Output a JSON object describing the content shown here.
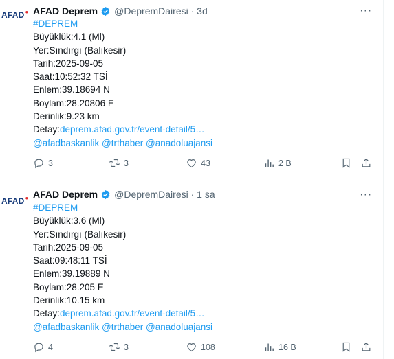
{
  "tweets": [
    {
      "author": "AFAD Deprem",
      "handle": "@DepremDairesi",
      "time": "· 3d",
      "avatar_text": "AFAD",
      "hashtag": "#DEPREM",
      "lines": [
        "Büyüklük:4.1 (Ml)",
        "Yer:Sındırgı (Balıkesir)",
        "Tarih:2025-09-05",
        "Saat:10:52:32 TSİ",
        "Enlem:39.18694 N",
        "Boylam:28.20806 E",
        "Derinlik:9.23 km"
      ],
      "detail_label": "Detay:",
      "detail_link": "deprem.afad.gov.tr/event-detail/5…",
      "mentions": "@afadbaskanlik @trthaber @anadoluajansi",
      "replies": "3",
      "retweets": "3",
      "likes": "43",
      "views": "2 B"
    },
    {
      "author": "AFAD Deprem",
      "handle": "@DepremDairesi",
      "time": "· 1 sa",
      "avatar_text": "AFAD",
      "hashtag": "#DEPREM",
      "lines": [
        "Büyüklük:3.6 (Ml)",
        "Yer:Sındırgı (Balıkesir)",
        "Tarih:2025-09-05",
        "Saat:09:48:11 TSİ",
        "Enlem:39.19889 N",
        "Boylam:28.205 E",
        "Derinlik:10.15 km"
      ],
      "detail_label": "Detay:",
      "detail_link": "deprem.afad.gov.tr/event-detail/5…",
      "mentions": "@afadbaskanlik @trthaber @anadoluajansi",
      "replies": "4",
      "retweets": "3",
      "likes": "108",
      "views": "16 B"
    }
  ],
  "colors": {
    "link": "#1d9bf0",
    "muted": "#536471",
    "text": "#0f1419",
    "verified": "#1d9bf0"
  },
  "icons": [
    "verified-badge-icon",
    "more-icon",
    "reply-icon",
    "retweet-icon",
    "like-icon",
    "views-icon",
    "bookmark-icon",
    "share-icon"
  ]
}
